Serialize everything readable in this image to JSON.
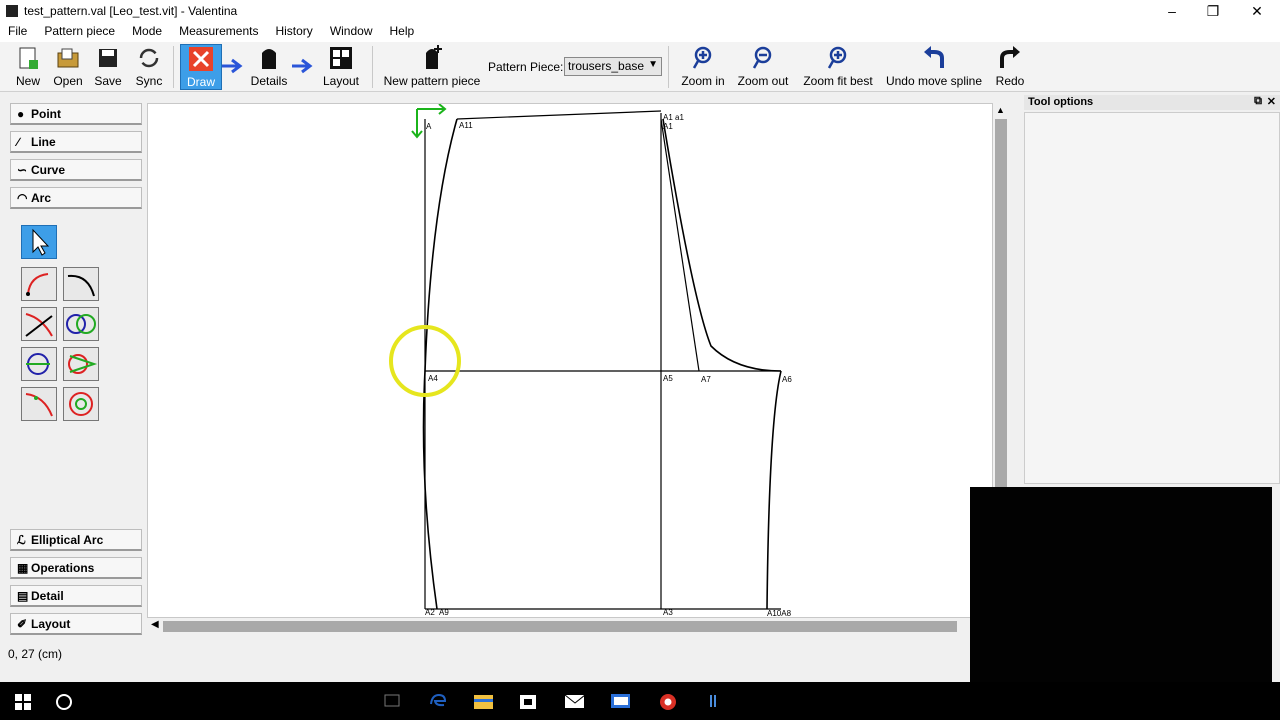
{
  "window": {
    "title": "test_pattern.val [Leo_test.vit] - Valentina"
  },
  "menu": {
    "file": "File",
    "pattern_piece": "Pattern piece",
    "mode": "Mode",
    "measurements": "Measurements",
    "history": "History",
    "window": "Window",
    "help": "Help"
  },
  "toolbar": {
    "new": "New",
    "open": "Open",
    "save": "Save",
    "sync": "Sync",
    "draw": "Draw",
    "details": "Details",
    "layout": "Layout",
    "new_piece": "New pattern piece",
    "piece_label": "Pattern Piece:",
    "piece_value": "trousers_base",
    "zoom_in": "Zoom in",
    "zoom_out": "Zoom out",
    "zoom_fit": "Zoom fit best",
    "undo": "Undo move spline",
    "redo": "Redo"
  },
  "tools": {
    "point": "Point",
    "line": "Line",
    "curve": "Curve",
    "arc": "Arc",
    "elliptical_arc": "Elliptical Arc",
    "operations": "Operations",
    "detail": "Detail",
    "layout": "Layout"
  },
  "tool_options": {
    "title": "Tool options"
  },
  "canvas": {
    "points": {
      "a": "A",
      "a11": "A11",
      "a1": "A1 a1",
      "a1b": "A1",
      "a4": "A4",
      "a5": "A5",
      "a7": "A7",
      "a6": "A6",
      "a2": "A2",
      "a9": "A9",
      "a3": "A3",
      "a10a8": "A10A8"
    },
    "axis_x": "X",
    "axis_y": "Y"
  },
  "status": {
    "coords": "0, 27 (cm)"
  },
  "colors": {
    "accent": "#3d9ee8",
    "axis": "#1bb41b",
    "highlight": "#e6e61e"
  }
}
